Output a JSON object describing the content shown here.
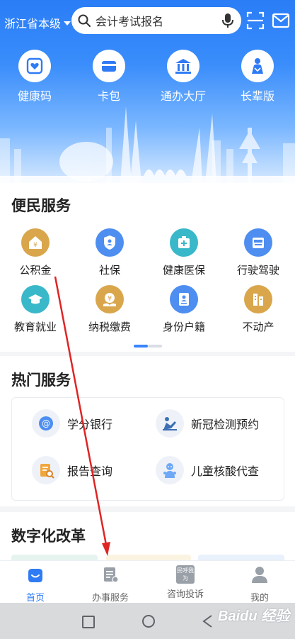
{
  "header": {
    "region": "浙江省本级",
    "search_placeholder": "会计考试报名",
    "quick": [
      {
        "label": "健康码",
        "icon": "health-code-icon"
      },
      {
        "label": "卡包",
        "icon": "card-wallet-icon"
      },
      {
        "label": "通办大厅",
        "icon": "government-hall-icon"
      },
      {
        "label": "长辈版",
        "icon": "elder-mode-icon"
      }
    ]
  },
  "convenience": {
    "title": "便民服务",
    "items": [
      {
        "label": "公积金",
        "icon": "provident-fund-icon",
        "color": "#d9a64c"
      },
      {
        "label": "社保",
        "icon": "social-security-icon",
        "color": "#4d8ef0"
      },
      {
        "label": "健康医保",
        "icon": "medical-insurance-icon",
        "color": "#39b8c9"
      },
      {
        "label": "行驶驾驶",
        "icon": "driving-license-icon",
        "color": "#4d8ef0"
      },
      {
        "label": "教育就业",
        "icon": "education-icon",
        "color": "#39b8c9"
      },
      {
        "label": "纳税缴费",
        "icon": "tax-payment-icon",
        "color": "#d9a64c"
      },
      {
        "label": "身份户籍",
        "icon": "id-registry-icon",
        "color": "#4d8ef0"
      },
      {
        "label": "不动产",
        "icon": "real-estate-icon",
        "color": "#d9a64c"
      }
    ]
  },
  "hot": {
    "title": "热门服务",
    "items": [
      {
        "label": "学分银行",
        "icon": "credit-bank-icon"
      },
      {
        "label": "新冠检测预约",
        "icon": "covid-test-icon"
      },
      {
        "label": "报告查询",
        "icon": "report-query-icon"
      },
      {
        "label": "儿童核酸代查",
        "icon": "child-test-icon"
      }
    ]
  },
  "digital": {
    "title": "数字化改革"
  },
  "nav": {
    "items": [
      {
        "label": "首页",
        "icon": "home-icon"
      },
      {
        "label": "办事服务",
        "icon": "services-icon"
      },
      {
        "label": "咨询投诉",
        "icon": "consult-icon",
        "badge": "民呼我为"
      },
      {
        "label": "我的",
        "icon": "profile-icon"
      }
    ]
  },
  "watermark": "Baidu 经验"
}
